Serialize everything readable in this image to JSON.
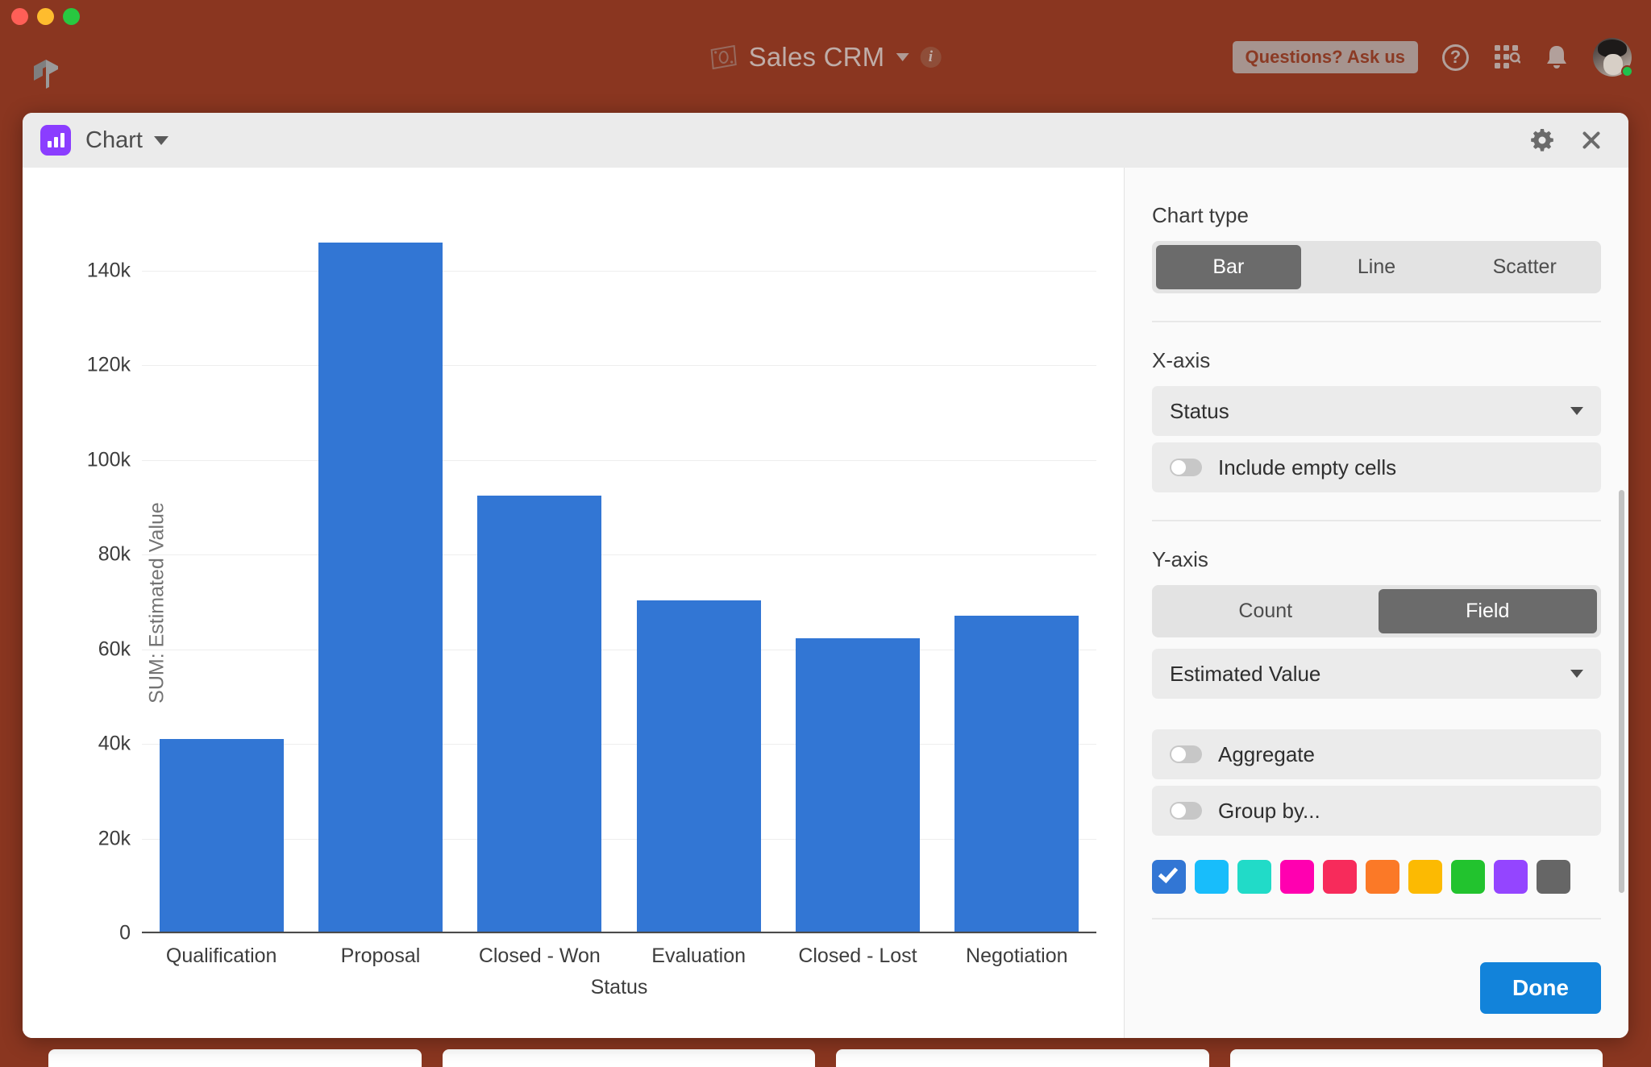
{
  "window": {
    "traffic_lights": [
      "close",
      "minimize",
      "maximize"
    ],
    "brand_icon": "cube-logo-icon"
  },
  "topbar": {
    "app_icon": "money-bill-icon",
    "app_title": "Sales CRM",
    "title_caret": "chevron-down-icon",
    "info_icon": "info-icon",
    "ask_label": "Questions? Ask us",
    "help_icon": "help-circle-icon",
    "apps_icon": "app-grid-search-icon",
    "notifications_icon": "bell-icon",
    "avatar": "user-avatar",
    "presence": "online",
    "bg_color": "#8a3620"
  },
  "card": {
    "icon": "chart-bar-icon",
    "title": "Chart",
    "title_caret": "chevron-down-icon",
    "settings_icon": "gear-icon",
    "close_icon": "close-icon"
  },
  "settings": {
    "chart_type": {
      "label": "Chart type",
      "options": [
        "Bar",
        "Line",
        "Scatter"
      ],
      "selected": "Bar"
    },
    "x_axis": {
      "label": "X-axis",
      "field": "Status",
      "caret": "chevron-down-icon",
      "include_empty_cells": {
        "label": "Include empty cells",
        "on": false
      }
    },
    "y_axis": {
      "label": "Y-axis",
      "mode_options": [
        "Count",
        "Field"
      ],
      "mode_selected": "Field",
      "field": "Estimated Value",
      "caret": "chevron-down-icon"
    },
    "aggregate": {
      "label": "Aggregate",
      "on": false
    },
    "group_by": {
      "label": "Group by...",
      "on": false
    },
    "colors": {
      "selected_index": 0,
      "swatches": [
        "#3276d4",
        "#18bdfb",
        "#21dbc8",
        "#ff00b0",
        "#f72b5b",
        "#fb7927",
        "#fcba02",
        "#22c32e",
        "#9445ff",
        "#666666"
      ]
    },
    "done_label": "Done"
  },
  "chart_data": {
    "type": "bar",
    "title": "",
    "xlabel": "Status",
    "ylabel": "SUM: Estimated Value",
    "categories": [
      "Qualification",
      "Proposal",
      "Closed - Won",
      "Evaluation",
      "Closed - Lost",
      "Negotiation"
    ],
    "values": [
      41000,
      146000,
      92500,
      70300,
      62400,
      67100
    ],
    "ytick_labels": [
      "0",
      "20k",
      "40k",
      "60k",
      "80k",
      "100k",
      "120k",
      "140k"
    ],
    "ytick_values": [
      0,
      20000,
      40000,
      60000,
      80000,
      100000,
      120000,
      140000
    ],
    "ylim": [
      0,
      155000
    ],
    "grid": true,
    "legend": false,
    "bar_color": "#3276d4"
  }
}
